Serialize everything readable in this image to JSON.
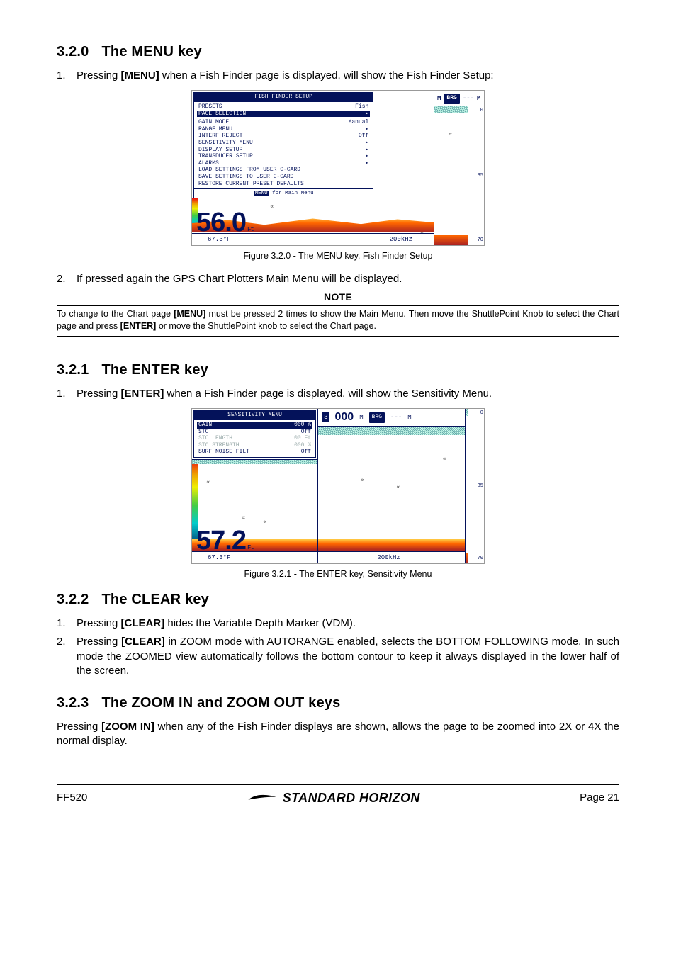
{
  "sections": {
    "s320": {
      "num": "3.2.0",
      "title": "The MENU key"
    },
    "s321": {
      "num": "3.2.1",
      "title": "The ENTER key"
    },
    "s322": {
      "num": "3.2.2",
      "title": "The CLEAR key"
    },
    "s323": {
      "num": "3.2.3",
      "title": "The ZOOM IN and ZOOM OUT keys"
    }
  },
  "text": {
    "s320_li1_a": "Pressing ",
    "s320_li1_b": "[MENU]",
    "s320_li1_c": " when a Fish Finder page is displayed, will show the Fish Finder Setup:",
    "s320_li2": "If pressed again the GPS Chart Plotters Main Menu will be displayed.",
    "note_head": "NOTE",
    "note_a": "To change to the Chart page ",
    "note_b": "[MENU]",
    "note_c": " must be pressed 2 times to show the Main Menu. Then move the ShuttlePoint Knob to select the Chart page and press ",
    "note_d": "[ENTER]",
    "note_e": " or move the ShuttlePoint knob to select the Chart page.",
    "s321_li1_a": "Pressing ",
    "s321_li1_b": "[ENTER]",
    "s321_li1_c": " when a Fish Finder page is displayed, will show the Sensitivity Menu.",
    "s322_li1_a": "Pressing ",
    "s322_li1_b": "[CLEAR]",
    "s322_li1_c": " hides the Variable Depth Marker (VDM).",
    "s322_li2_a": "Pressing ",
    "s322_li2_b": "[CLEAR]",
    "s322_li2_c": " in ZOOM mode with AUTORANGE enabled, selects the BOTTOM FOLLOWING mode. In such mode the ZOOMED view automatically follows the bottom contour to keep it always displayed in the lower half of the screen.",
    "s323_p_a": "Pressing ",
    "s323_p_b": "[ZOOM IN]",
    "s323_p_c": " when any of the Fish Finder displays are shown, allows the page to be zoomed into 2X or 4X the normal display."
  },
  "fig": {
    "cap320": "Figure 3.2.0 - The MENU key, Fish Finder Setup",
    "cap321": "Figure 3.2.1 - The ENTER key, Sensitivity Menu"
  },
  "shot1": {
    "menu_title": "FISH FINDER SETUP",
    "rows": [
      {
        "l": "PRESETS",
        "r": "Fish",
        "sel": false
      },
      {
        "l": "PAGE SELECTION",
        "r": "▸",
        "sel": true
      },
      {
        "l": "GAIN MODE",
        "r": "Manual",
        "sel": false
      },
      {
        "l": "RANGE MENU",
        "r": "▸",
        "sel": false
      },
      {
        "l": "INTERF REJECT",
        "r": "Off",
        "sel": false
      },
      {
        "l": "SENSITIVITY MENU",
        "r": "▸",
        "sel": false
      },
      {
        "l": "DISPLAY SETUP",
        "r": "▸",
        "sel": false
      },
      {
        "l": "TRANSDUCER SETUP",
        "r": "▸",
        "sel": false
      },
      {
        "l": "ALARMS",
        "r": "▸",
        "sel": false
      },
      {
        "l": "LOAD SETTINGS FROM USER C-CARD",
        "r": "",
        "sel": false
      },
      {
        "l": "SAVE SETTINGS TO USER C-CARD",
        "r": "",
        "sel": false
      },
      {
        "l": "RESTORE CURRENT PRESET DEFAULTS",
        "r": "",
        "sel": false
      }
    ],
    "hint_pre": "MENU",
    "hint_post": " for Main Menu",
    "depth": "56.0",
    "unit": "Ft",
    "temp": "67.3°F",
    "freq": "200kHz",
    "brg_label": "BRG",
    "brg_val": "---",
    "brg_unit": "M",
    "brg_left": "M",
    "scale_mid": "35",
    "scale_bot": "70"
  },
  "shot2": {
    "menu_title": "SENSITIVITY MENU",
    "rows": [
      {
        "l": "GAIN",
        "r": "000 %",
        "sel": true,
        "dim": false
      },
      {
        "l": "STC",
        "r": "Off",
        "sel": false,
        "dim": false
      },
      {
        "l": "STC LENGTH",
        "r": "00 Ft",
        "sel": false,
        "dim": true
      },
      {
        "l": "STC STRENGTH",
        "r": "000 %",
        "sel": false,
        "dim": true
      },
      {
        "l": "SURF NOISE FILT",
        "r": "Off",
        "sel": false,
        "dim": false
      }
    ],
    "hdr_val": "000",
    "hdr_unit": "M",
    "brg_label": "BRG",
    "brg_val": "---",
    "brg_unit": "M",
    "depth": "57.2",
    "unit": "Ft",
    "temp": "67.3°F",
    "freq": "200kHz",
    "left_num": "3",
    "scale_mid": "35",
    "scale_bot": "70"
  },
  "footer": {
    "left": "FF520",
    "brand": "STANDARD HORIZON",
    "right": "Page 21"
  }
}
